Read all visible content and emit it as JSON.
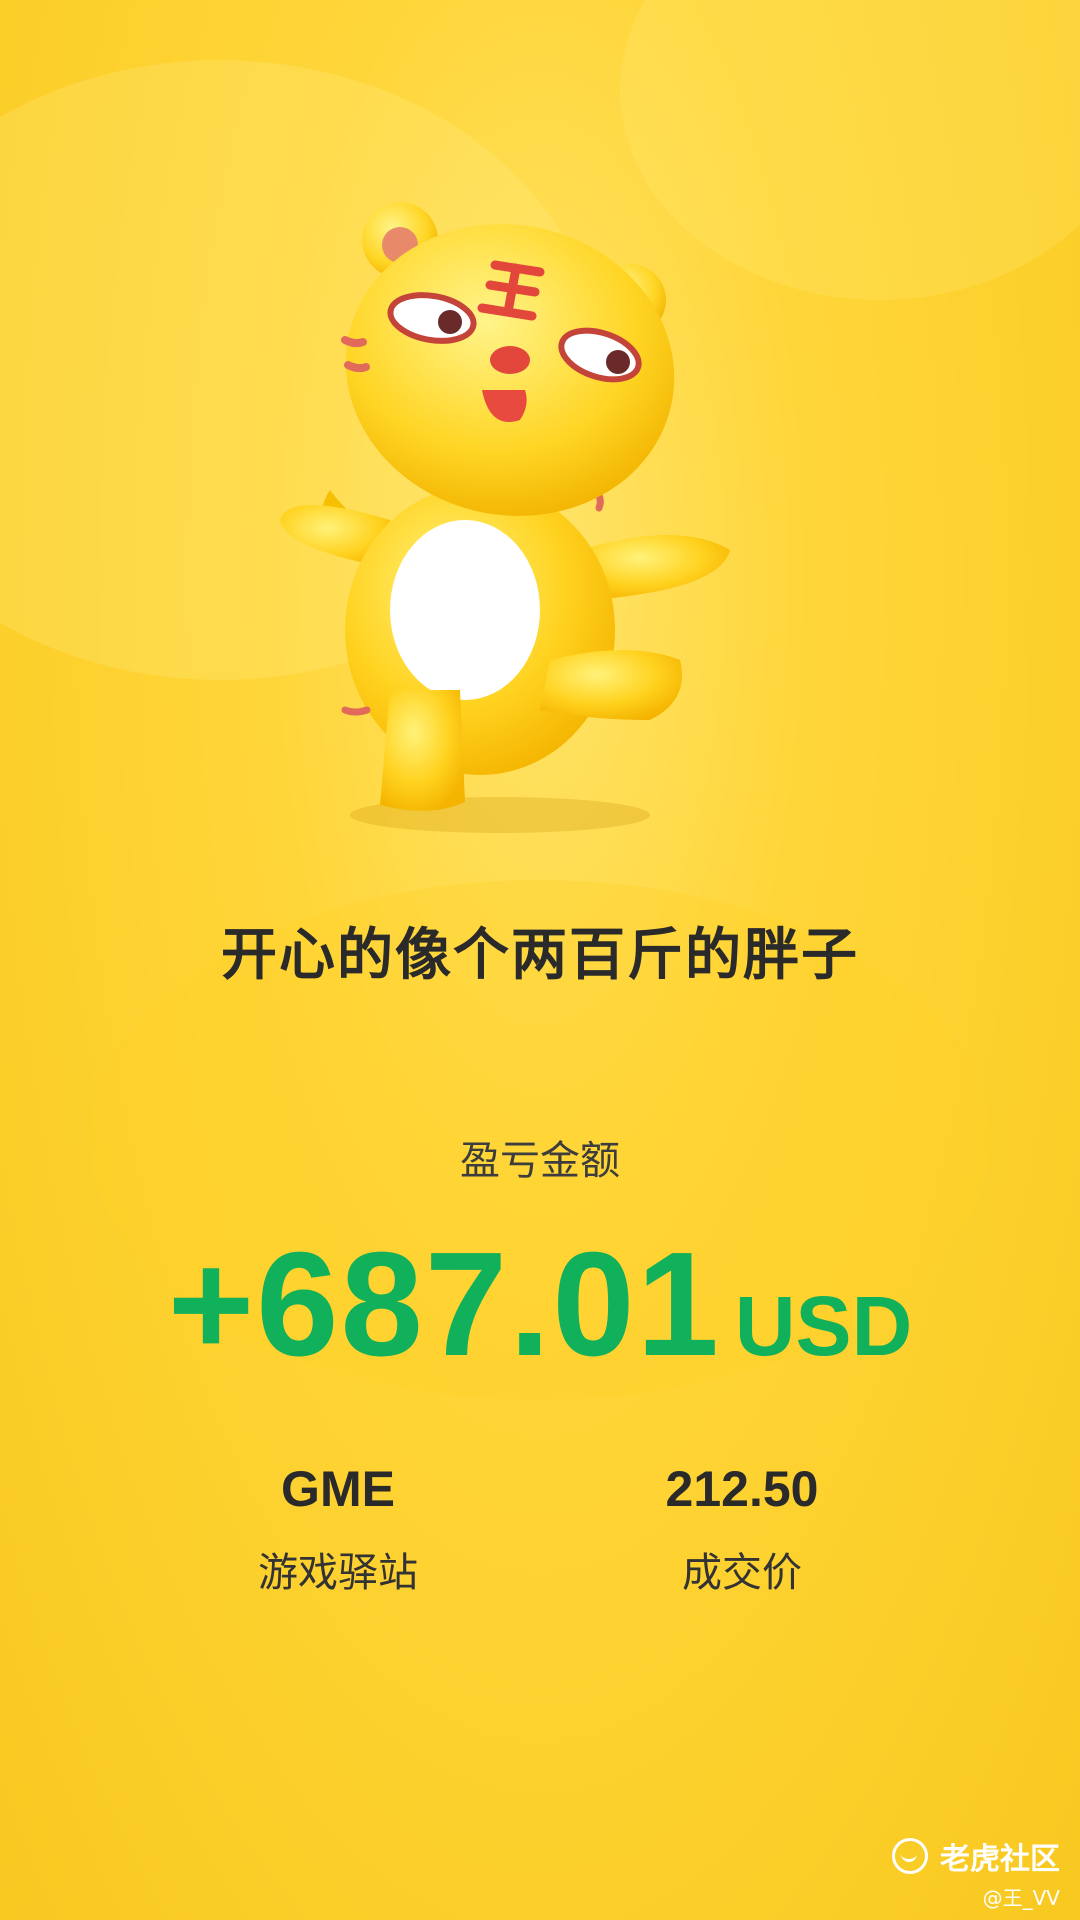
{
  "headline": "开心的像个两百斤的胖子",
  "profit_loss": {
    "label": "盈亏金额",
    "amount": "+687.01",
    "currency": "USD",
    "color": "#11b05a"
  },
  "stats": {
    "left": {
      "value": "GME",
      "caption": "游戏驿站"
    },
    "right": {
      "value": "212.50",
      "caption": "成交价"
    }
  },
  "watermark": {
    "brand": "老虎社区",
    "handle": "@王_VV",
    "logo_icon": "smile-circle-icon"
  },
  "colors": {
    "background": "#fcd22d",
    "text_dark": "#2a2a2a",
    "profit_green": "#11b05a"
  },
  "mascot": {
    "icon": "tiger-mascot-icon"
  }
}
